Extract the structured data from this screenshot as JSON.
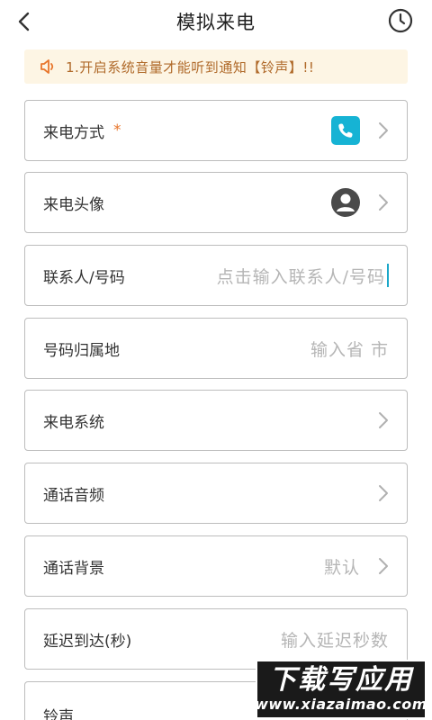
{
  "header": {
    "title": "模拟来电",
    "back_icon": "chevron-left-icon",
    "history_icon": "clock-icon"
  },
  "notice": {
    "icon": "speaker-icon",
    "text": "1.开启系统音量才能听到通知【铃声】!!",
    "color": "#b06a2a",
    "background": "#fdf5e4"
  },
  "form": {
    "call_method": {
      "label": "来电方式",
      "required_mark": "*",
      "icon": "phone-icon",
      "icon_color": "#16b3d4"
    },
    "call_avatar": {
      "label": "来电头像",
      "icon": "avatar-icon"
    },
    "contact": {
      "label": "联系人/号码",
      "placeholder": "点击输入联系人/号码"
    },
    "location": {
      "label": "号码归属地",
      "placeholder": "输入省 市"
    },
    "call_system": {
      "label": "来电系统"
    },
    "call_audio": {
      "label": "通话音频"
    },
    "call_background": {
      "label": "通话背景",
      "value": "默认"
    },
    "delay": {
      "label": "延迟到达(秒)",
      "placeholder": "输入延迟秒数"
    },
    "ringtone": {
      "label": "铃声"
    }
  },
  "watermark": {
    "title": "下载写应用",
    "url": "www.xiazaimao.com"
  },
  "colors": {
    "accent": "#16b3d4",
    "border": "#bdbdbd",
    "placeholder": "#b5b5b5",
    "required": "#e8762c"
  }
}
